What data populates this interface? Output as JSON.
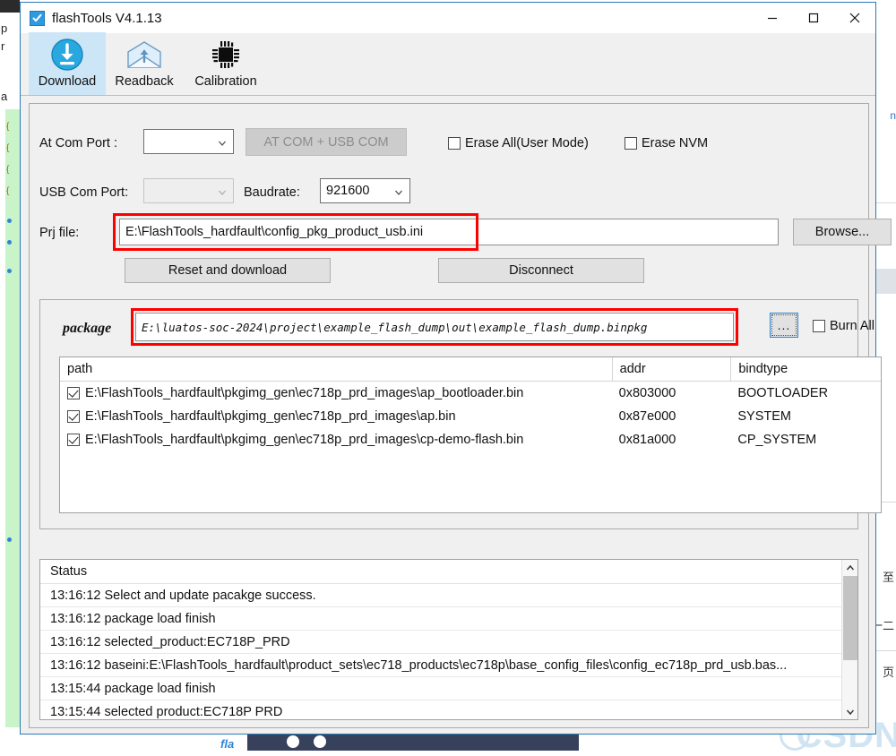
{
  "window": {
    "title": "flashTools V4.1.13",
    "app_icon": "flash-tool-icon",
    "minimize_label": "—",
    "maximize_label": "□",
    "close_label": "✕"
  },
  "toolbar": {
    "tabs": [
      {
        "label": "Download",
        "icon": "download-circle-icon",
        "active": true
      },
      {
        "label": "Readback",
        "icon": "envelope-upload-icon",
        "active": false
      },
      {
        "label": "Calibration",
        "icon": "chip-icon",
        "active": false
      }
    ]
  },
  "form": {
    "at_com_port_label": "At Com Port  :",
    "at_com_port_value": "",
    "at_com_usb_button": "AT COM + USB COM",
    "usb_com_port_label": "USB Com Port:",
    "usb_com_port_value": "",
    "baudrate_label": "Baudrate:",
    "baudrate_value": "921600",
    "prj_file_label": "Prj file:",
    "prj_file_value": "E:\\FlashTools_hardfault\\config_pkg_product_usb.ini",
    "browse_button": "Browse...",
    "reset_download_button": "Reset and download",
    "disconnect_button": "Disconnect",
    "erase_all_label": "Erase All(User Mode)",
    "erase_all_checked": false,
    "erase_nvm_label": "Erase NVM",
    "erase_nvm_checked": false
  },
  "package": {
    "label": "package",
    "path_value": "E:\\luatos-soc-2024\\project\\example_flash_dump\\out\\example_flash_dump.binpkg",
    "browse_dots_button": "...",
    "burn_all_label": "Burn All",
    "burn_all_checked": false,
    "columns": [
      "path",
      "addr",
      "bindtype"
    ],
    "rows": [
      {
        "checked": true,
        "path": "E:\\FlashTools_hardfault\\pkgimg_gen\\ec718p_prd_images\\ap_bootloader.bin",
        "addr": "0x803000",
        "bindtype": "BOOTLOADER"
      },
      {
        "checked": true,
        "path": "E:\\FlashTools_hardfault\\pkgimg_gen\\ec718p_prd_images\\ap.bin",
        "addr": "0x87e000",
        "bindtype": "SYSTEM"
      },
      {
        "checked": true,
        "path": "E:\\FlashTools_hardfault\\pkgimg_gen\\ec718p_prd_images\\cp-demo-flash.bin",
        "addr": "0x81a000",
        "bindtype": "CP_SYSTEM"
      }
    ]
  },
  "status": {
    "header": "Status",
    "lines": [
      "13:16:12 Select and update pacakge success.",
      "13:16:12 package load finish",
      "13:16:12 selected_product:EC718P_PRD",
      "13:16:12 baseini:E:\\FlashTools_hardfault\\product_sets\\ec718_products\\ec718p\\base_config_files\\config_ec718p_prd_usb.bas...",
      "13:15:44 package load finish",
      "13:15:44 selected product:EC718P PRD"
    ]
  },
  "background": {
    "left_text_fragments": [
      "p",
      "r",
      "a"
    ],
    "right_text_fragments": [
      "至",
      "一二",
      "页"
    ],
    "right_link_fragment": "n",
    "watermark": "CSDN",
    "taskbar_text": "fla"
  },
  "colors": {
    "accent_blue": "#2f84d6",
    "active_tab": "#cce6f7",
    "highlight_red": "#ff0000",
    "window_border": "#2a7ab8",
    "panel_bg": "#f0f0f0"
  }
}
